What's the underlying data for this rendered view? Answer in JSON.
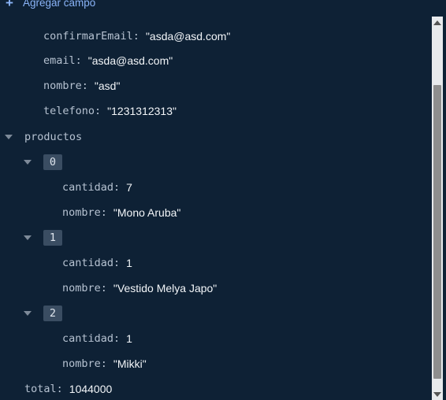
{
  "add_field": {
    "label": "Agregar campo",
    "icon": "plus-icon"
  },
  "cliente": {
    "confirmarEmail": {
      "key": "confirmarEmail",
      "value": "\"asda@asd.com\""
    },
    "email": {
      "key": "email",
      "value": "\"asda@asd.com\""
    },
    "nombre": {
      "key": "nombre",
      "value": "\"asd\""
    },
    "telefono": {
      "key": "telefono",
      "value": "\"1231312313\""
    }
  },
  "productos": {
    "key": "productos",
    "items": [
      {
        "index": "0",
        "cantidad": {
          "key": "cantidad",
          "value": "7"
        },
        "nombre": {
          "key": "nombre",
          "value": "\"Mono Aruba\""
        }
      },
      {
        "index": "1",
        "cantidad": {
          "key": "cantidad",
          "value": "1"
        },
        "nombre": {
          "key": "nombre",
          "value": "\"Vestido Melya Japo\""
        }
      },
      {
        "index": "2",
        "cantidad": {
          "key": "cantidad",
          "value": "1"
        },
        "nombre": {
          "key": "nombre",
          "value": "\"Mikki\""
        }
      }
    ]
  },
  "total": {
    "key": "total",
    "value": "1044000"
  },
  "colors": {
    "background": "#0e2135",
    "key": "#b6c2d1",
    "value": "#f2f5f8",
    "link": "#8ab4f8",
    "index_badge": "#3a4d62"
  },
  "icons": {
    "expand": "caret-down-icon",
    "scroll_up": "scroll-up-arrow-icon",
    "scroll_down": "scroll-down-arrow-icon"
  }
}
